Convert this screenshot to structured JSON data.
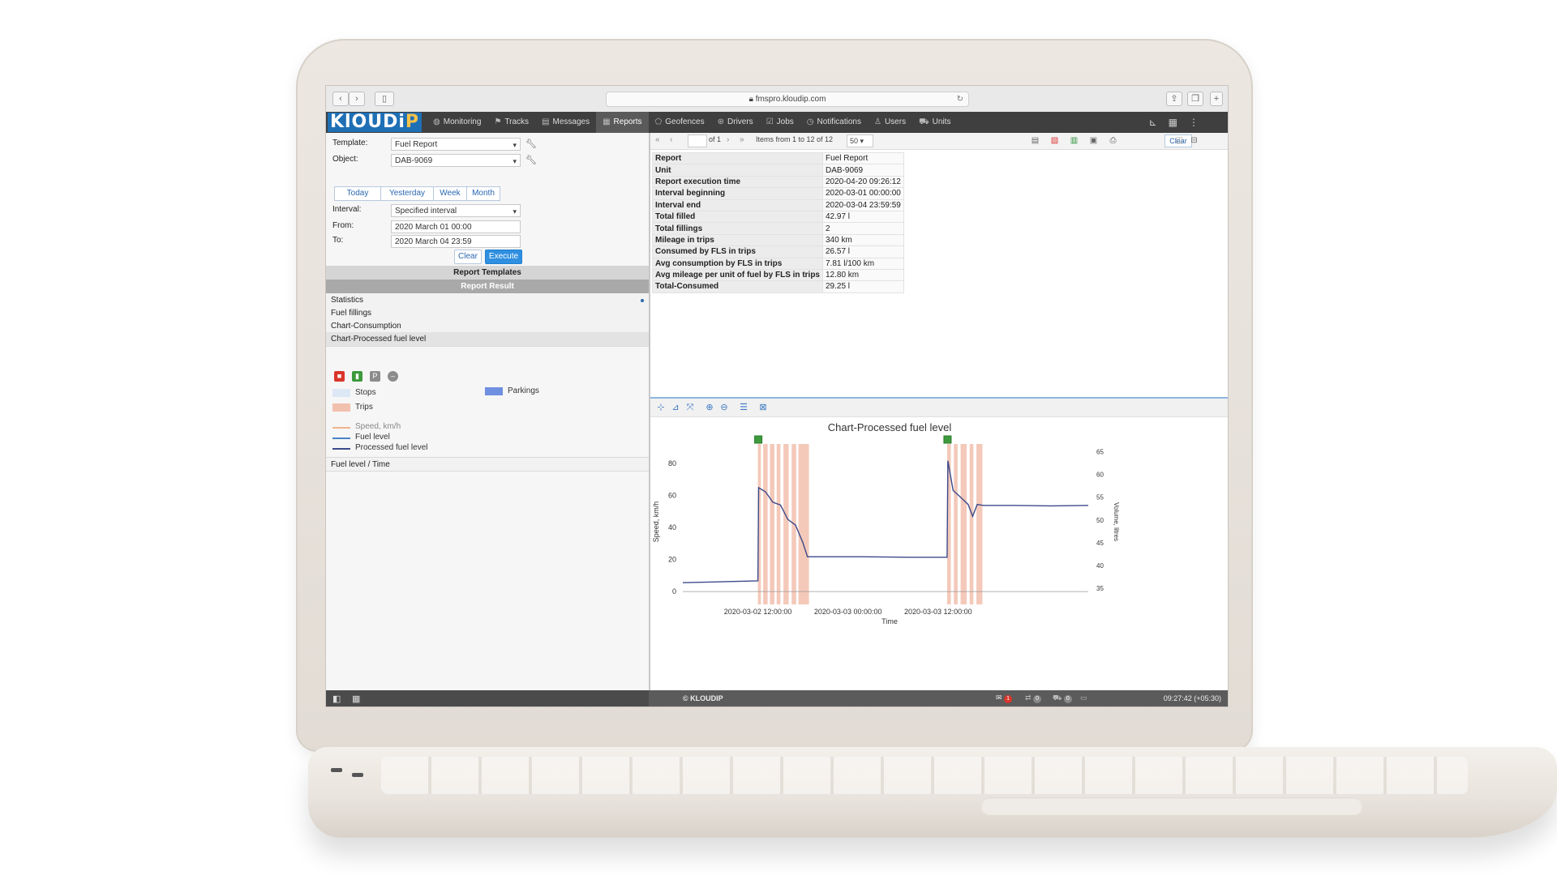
{
  "browser": {
    "url": "fmspro.kloudip.com"
  },
  "app": {
    "logo_main": "KlOUDi",
    "logo_accent": "P",
    "nav": [
      {
        "label": "Monitoring",
        "icon": "globe-icon"
      },
      {
        "label": "Tracks",
        "icon": "flag-icon"
      },
      {
        "label": "Messages",
        "icon": "message-icon"
      },
      {
        "label": "Reports",
        "icon": "report-icon"
      },
      {
        "label": "Geofences",
        "icon": "geofence-icon"
      },
      {
        "label": "Drivers",
        "icon": "steering-wheel-icon"
      },
      {
        "label": "Jobs",
        "icon": "clipboard-icon"
      },
      {
        "label": "Notifications",
        "icon": "clock-icon"
      },
      {
        "label": "Users",
        "icon": "user-icon"
      },
      {
        "label": "Units",
        "icon": "truck-icon"
      }
    ],
    "active_nav": "Reports"
  },
  "form": {
    "template_label": "Template:",
    "template_value": "Fuel Report",
    "object_label": "Object:",
    "object_value": "DAB-9069",
    "periods": [
      "Today",
      "Yesterday",
      "Week",
      "Month"
    ],
    "interval_label": "Interval:",
    "interval_value": "Specified interval",
    "from_label": "From:",
    "from_value": "2020 March 01 00:00",
    "to_label": "To:",
    "to_value": "2020 March 04 23:59",
    "clear_label": "Clear",
    "execute_label": "Execute"
  },
  "sections": {
    "templates_title": "Report Templates",
    "result_title": "Report Result",
    "results": [
      "Statistics",
      "Fuel fillings",
      "Chart-Consumption",
      "Chart-Processed fuel level"
    ],
    "legend": {
      "stops": "Stops",
      "parkings": "Parkings",
      "trips": "Trips",
      "speed": "Speed, km/h",
      "fuel_level": "Fuel level",
      "processed": "Processed fuel level"
    },
    "after": "Fuel level / Time"
  },
  "colors": {
    "stops": "#dce8f5",
    "parkings": "#6f8fe0",
    "trips": "#f2c0ae",
    "speed": "#f0b48f",
    "fuel": "#4a84c4",
    "processed": "#3c4a8a"
  },
  "table_toolbar": {
    "of_label": "of 1",
    "items_label": "Items from 1 to 12 of 12",
    "page_size": "50",
    "clear_label": "Clear"
  },
  "stats": [
    {
      "k": "Report",
      "v": "Fuel Report"
    },
    {
      "k": "Unit",
      "v": "DAB-9069"
    },
    {
      "k": "Report execution time",
      "v": "2020-04-20 09:26:12"
    },
    {
      "k": "Interval beginning",
      "v": "2020-03-01 00:00:00"
    },
    {
      "k": "Interval end",
      "v": "2020-03-04 23:59:59"
    },
    {
      "k": "Total filled",
      "v": "42.97 l"
    },
    {
      "k": "Total fillings",
      "v": "2"
    },
    {
      "k": "Mileage in trips",
      "v": "340 km"
    },
    {
      "k": "Consumed by FLS in trips",
      "v": "26.57 l"
    },
    {
      "k": "Avg consumption by FLS in trips",
      "v": "7.81 l/100 km"
    },
    {
      "k": "Avg mileage per unit of fuel by FLS in trips",
      "v": "12.80 km"
    },
    {
      "k": "Total-Consumed",
      "v": "29.25 l"
    }
  ],
  "chart_data": {
    "type": "line",
    "title": "Chart-Processed fuel level",
    "xlabel": "Time",
    "ylabel": "Speed, km/h",
    "y2label": "Volume, litres",
    "x_ticks": [
      "2020-03-02 12:00:00",
      "2020-03-03 00:00:00",
      "2020-03-03 12:00:00"
    ],
    "x_tick_hours": [
      36,
      48,
      60
    ],
    "xlim": [
      26,
      80
    ],
    "ylim": [
      -5,
      90
    ],
    "y_ticks": [
      0,
      20,
      40,
      60,
      80
    ],
    "y2lim": [
      32.5,
      66
    ],
    "y2_ticks": [
      35,
      40,
      45,
      50,
      55,
      60,
      65
    ],
    "grid": false,
    "trips": [
      [
        36.0,
        36.4
      ],
      [
        36.7,
        37.3
      ],
      [
        37.6,
        38.2
      ],
      [
        38.5,
        39.0
      ],
      [
        39.4,
        40.1
      ],
      [
        40.5,
        41.1
      ],
      [
        41.4,
        42.8
      ],
      [
        61.2,
        61.7
      ],
      [
        62.1,
        62.6
      ],
      [
        63.0,
        63.8
      ],
      [
        64.2,
        64.7
      ],
      [
        65.1,
        65.9
      ]
    ],
    "fillings_at": [
      36.0,
      61.2
    ],
    "series": [
      {
        "name": "Processed fuel level",
        "axis": "right",
        "x": [
          26,
          36.0,
          36.1,
          37.0,
          38.0,
          39.0,
          40.0,
          41.0,
          42.0,
          42.6,
          43.0,
          50,
          56,
          61.2,
          61.3,
          62.0,
          63.0,
          64.0,
          64.6,
          65.2,
          66.0,
          70,
          75,
          80
        ],
        "y": [
          36.2,
          36.6,
          57.1,
          56.2,
          53.9,
          53.3,
          50.1,
          48.9,
          45.0,
          41.9,
          41.9,
          41.9,
          41.8,
          41.8,
          63.0,
          56.5,
          55.0,
          53.4,
          50.8,
          53.4,
          53.2,
          53.2,
          53.1,
          53.2
        ]
      },
      {
        "name": "Speed, km/h",
        "axis": "left",
        "x": [
          26,
          80
        ],
        "y": [
          0,
          0
        ]
      }
    ]
  },
  "statusbar": {
    "copyright": "© KLOUDIP",
    "notif_count": "1",
    "count2": "0",
    "count3": "0",
    "time": "09:27:42 (+05:30)"
  }
}
